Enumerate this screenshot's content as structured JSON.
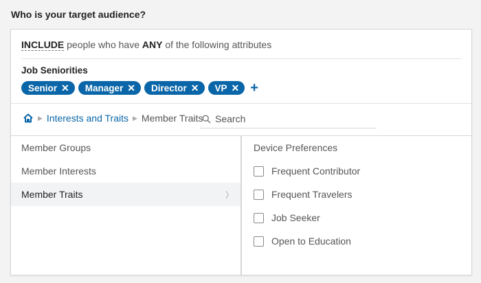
{
  "heading": "Who is your target audience?",
  "include": {
    "keyword": "INCLUDE",
    "text1": " people who have ",
    "any": "ANY",
    "text2": " of the following attributes"
  },
  "seniorities": {
    "label": "Job Seniorities",
    "pills": [
      "Senior",
      "Manager",
      "Director",
      "VP"
    ],
    "remove_glyph": "✕",
    "add_glyph": "+"
  },
  "breadcrumb": {
    "home_icon": "home-icon",
    "link": "Interests and Traits",
    "current": "Member Traits"
  },
  "search": {
    "placeholder": "Search"
  },
  "left_items": [
    {
      "label": "Member Groups"
    },
    {
      "label": "Member Interests"
    },
    {
      "label": "Member Traits"
    }
  ],
  "right_panel": {
    "header": "Device Preferences",
    "options": [
      "Frequent Contributor",
      "Frequent Travelers",
      "Job Seeker",
      "Open to Education"
    ]
  },
  "colors": {
    "accent": "#0a66a8",
    "pill_bg": "#0a66a8"
  }
}
